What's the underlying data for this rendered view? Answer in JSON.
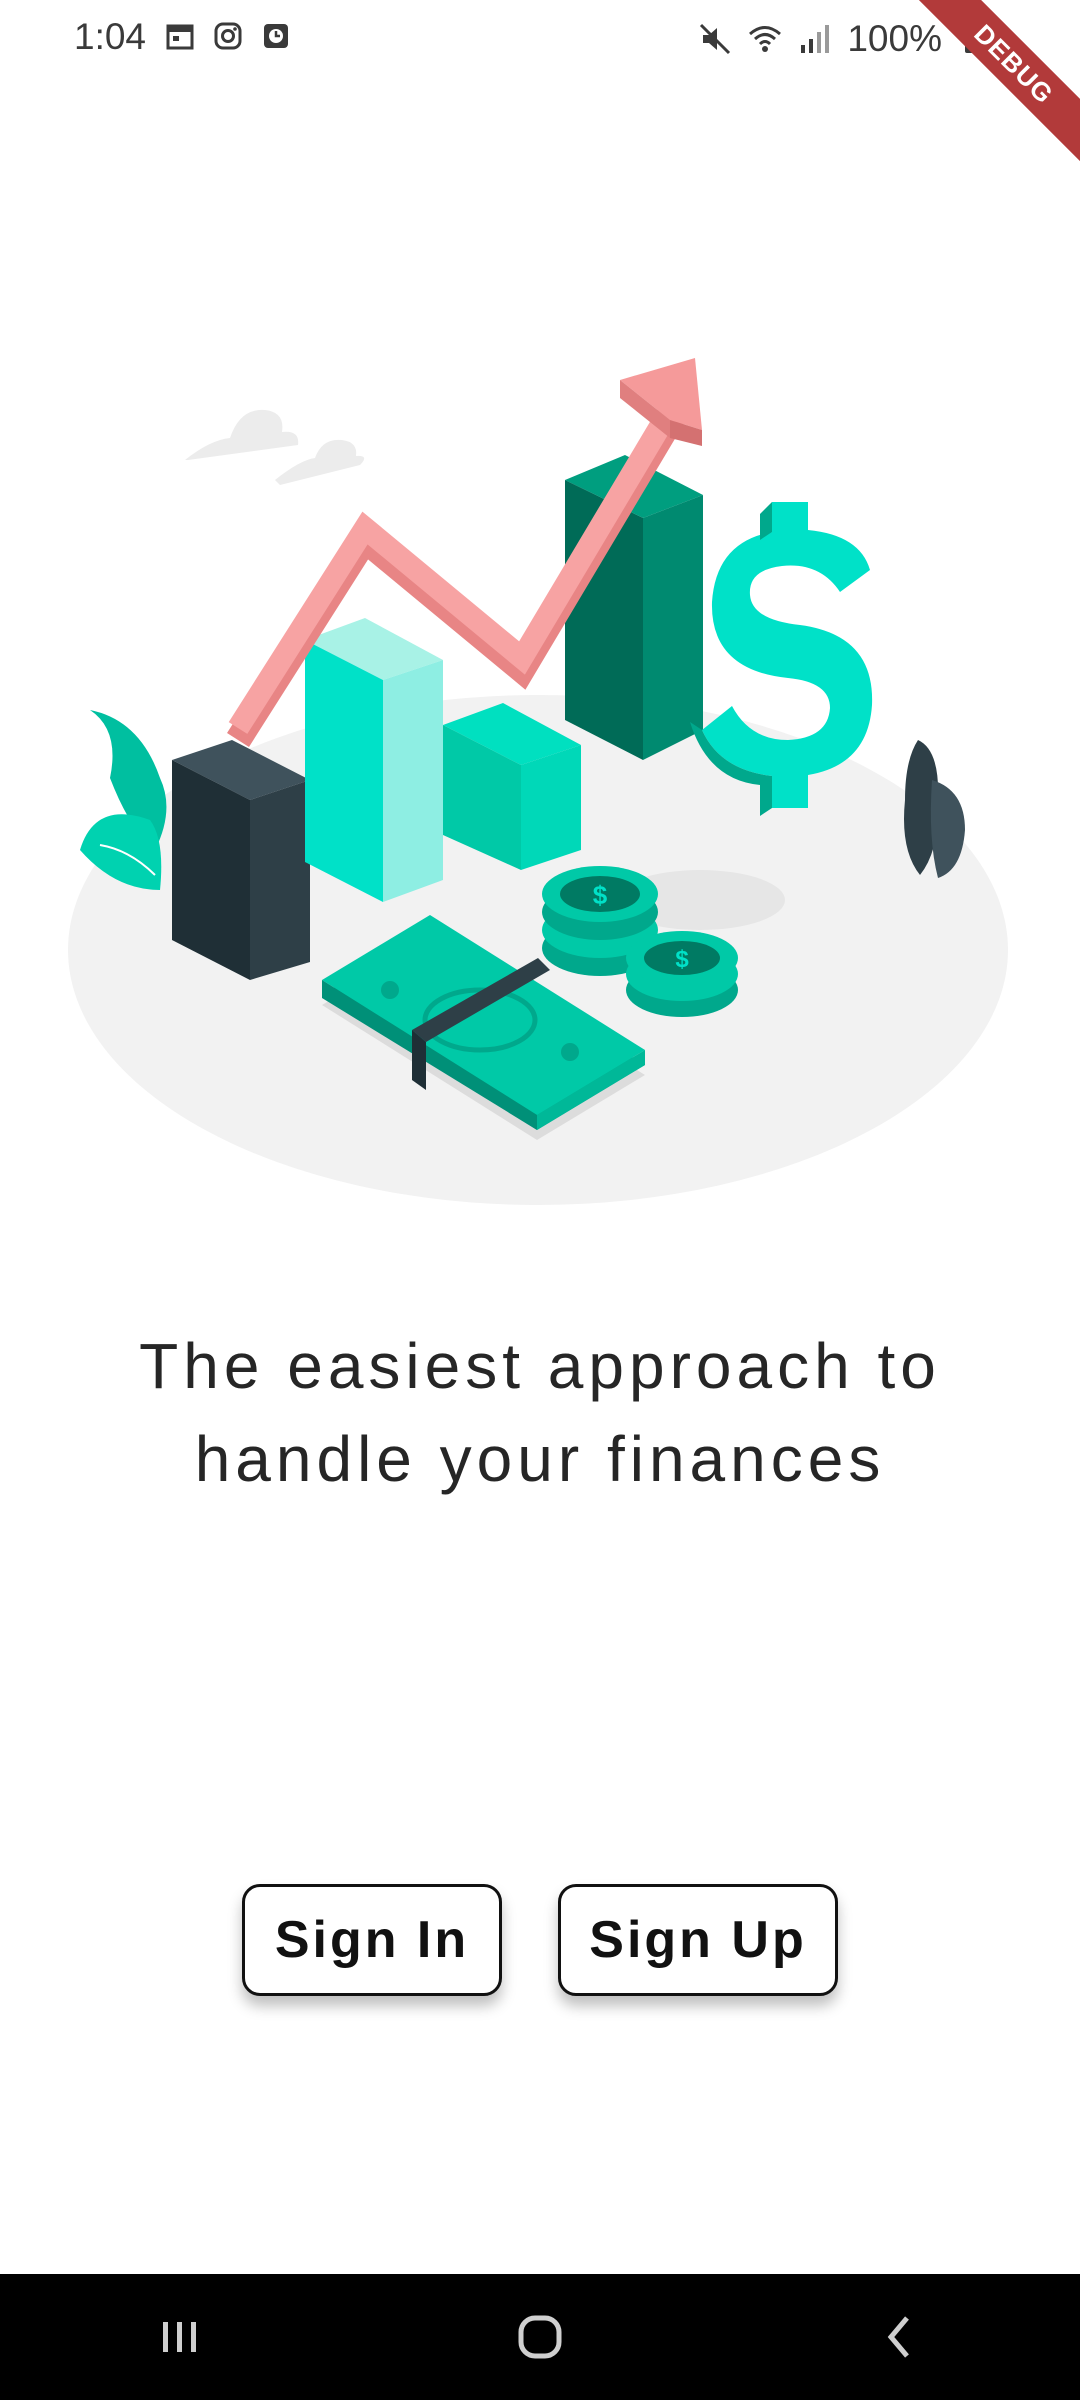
{
  "status_bar": {
    "time": "1:04",
    "battery": "100%",
    "left_icons": [
      "calendar-icon",
      "instagram-icon",
      "clock-app-icon"
    ],
    "right_icons": [
      "mute-icon",
      "wifi-icon",
      "signal-icon",
      "battery-icon"
    ]
  },
  "debug_banner": "DEBUG",
  "headline": {
    "line1": "The easiest approach to",
    "line2": "handle your finances"
  },
  "buttons": {
    "sign_in": "Sign In",
    "sign_up": "Sign Up"
  },
  "nav": [
    "recents-icon",
    "home-icon",
    "back-icon"
  ],
  "colors": {
    "accent": "#00C9A7",
    "dark_teal": "#006B57",
    "arrow": "#F59A9A",
    "dark_bar": "#2E3F47"
  }
}
